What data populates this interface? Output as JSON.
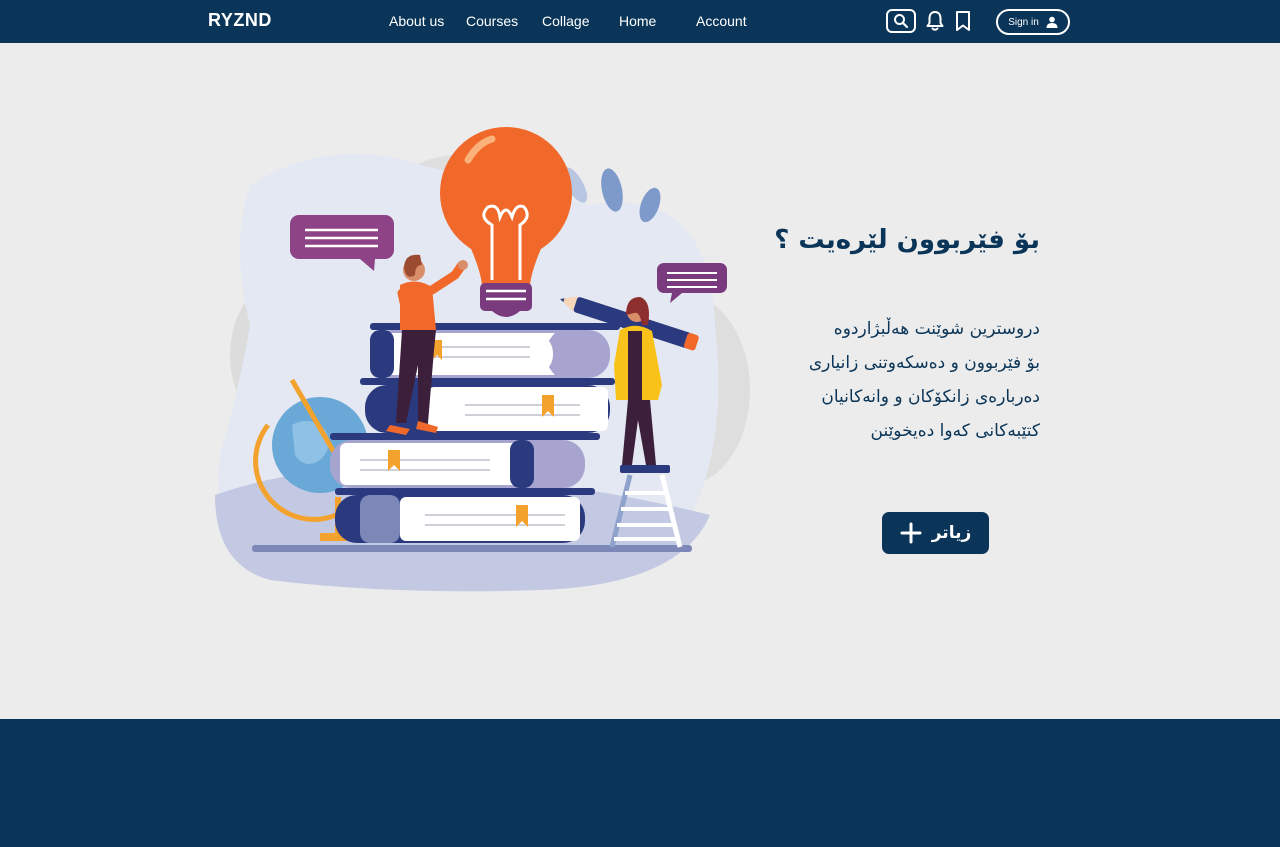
{
  "header": {
    "brand": "RYZND",
    "nav": {
      "about": "About us",
      "courses": "Courses",
      "collage": "Collage",
      "home": "Home",
      "account": "Account"
    },
    "search_icon": "search-icon",
    "bell_icon": "bell-icon",
    "bookmark_icon": "bookmark-icon",
    "signin_label": "Sign in",
    "user_icon": "user-icon"
  },
  "hero": {
    "title": "بۆ فێربوون لێرەیت ؟",
    "lines": [
      "دروسترین شوێنت هەڵبژاردوە",
      "بۆ فێربوون و دەسکەوتنی زانیاری",
      "دەربارەی زانکۆکان و وانەکانیان",
      "کتێبەکانی کەوا دەیخوێنن"
    ],
    "more_label": "زیاتر",
    "plus_icon": "plus-icon"
  },
  "colors": {
    "navy": "#0a3558",
    "background": "#ececec",
    "orange": "#f26522",
    "purple": "#7a3a7e"
  }
}
